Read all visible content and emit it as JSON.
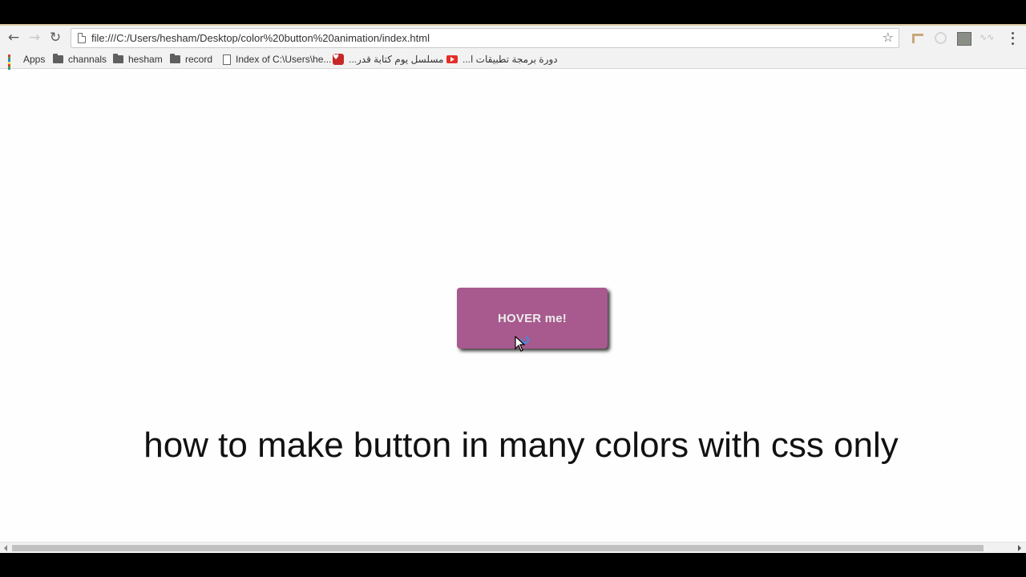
{
  "browser": {
    "url": "file:///C:/Users/hesham/Desktop/color%20button%20animation/index.html"
  },
  "bookmarks": [
    {
      "label": "Apps",
      "icon": "apps-grid-icon"
    },
    {
      "label": "channals",
      "icon": "folder-icon"
    },
    {
      "label": "hesham",
      "icon": "folder-icon"
    },
    {
      "label": "record",
      "icon": "folder-icon"
    },
    {
      "label": "Index of C:\\Users\\he...",
      "icon": "file-icon"
    },
    {
      "label": "مسلسل يوم كتابة قدر...",
      "icon": "heart-icon"
    },
    {
      "label": "دورة برمجة تطبيقات ا...",
      "icon": "youtube-icon"
    }
  ],
  "page": {
    "button_label": "HOVER me!",
    "headline": "how to make button in many colors with css only"
  },
  "colors": {
    "button": "#a85a8e",
    "button_text": "#ececec"
  }
}
